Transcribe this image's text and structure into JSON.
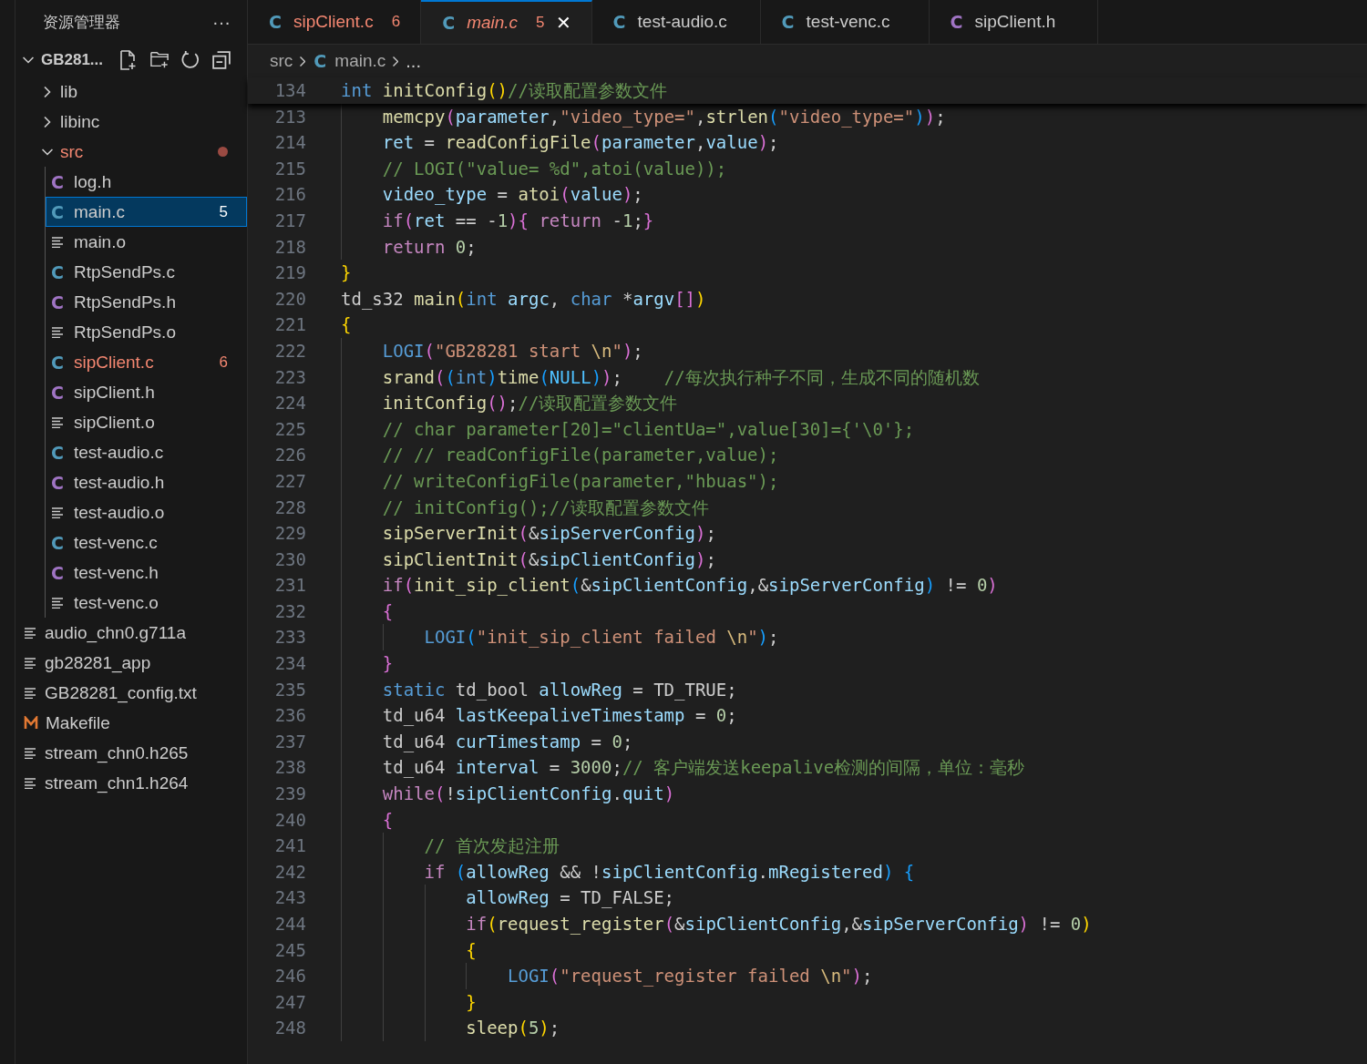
{
  "sidebar": {
    "title": "资源管理器",
    "more": "···",
    "root": {
      "label": "GB281...",
      "expanded": true
    },
    "items": [
      {
        "name": "lib",
        "kind": "folder",
        "expanded": false,
        "selected": false,
        "error": false
      },
      {
        "name": "libinc",
        "kind": "folder",
        "expanded": false,
        "selected": false,
        "error": false
      },
      {
        "name": "src",
        "kind": "folder",
        "expanded": true,
        "selected": false,
        "error": true,
        "children": [
          {
            "name": "log.h",
            "kind": "h",
            "icon": "C",
            "selected": false,
            "error": false
          },
          {
            "name": "main.c",
            "kind": "c",
            "icon": "C",
            "selected": true,
            "error": true,
            "badge": "5"
          },
          {
            "name": "main.o",
            "kind": "file",
            "selected": false,
            "error": false
          },
          {
            "name": "RtpSendPs.c",
            "kind": "c",
            "icon": "C",
            "selected": false,
            "error": false
          },
          {
            "name": "RtpSendPs.h",
            "kind": "h",
            "icon": "C",
            "selected": false,
            "error": false
          },
          {
            "name": "RtpSendPs.o",
            "kind": "file",
            "selected": false,
            "error": false
          },
          {
            "name": "sipClient.c",
            "kind": "c",
            "icon": "C",
            "selected": false,
            "error": true,
            "badge": "6"
          },
          {
            "name": "sipClient.h",
            "kind": "h",
            "icon": "C",
            "selected": false,
            "error": false
          },
          {
            "name": "sipClient.o",
            "kind": "file",
            "selected": false,
            "error": false
          },
          {
            "name": "test-audio.c",
            "kind": "c",
            "icon": "C",
            "selected": false,
            "error": false
          },
          {
            "name": "test-audio.h",
            "kind": "h",
            "icon": "C",
            "selected": false,
            "error": false
          },
          {
            "name": "test-audio.o",
            "kind": "file",
            "selected": false,
            "error": false
          },
          {
            "name": "test-venc.c",
            "kind": "c",
            "icon": "C",
            "selected": false,
            "error": false
          },
          {
            "name": "test-venc.h",
            "kind": "h",
            "icon": "C",
            "selected": false,
            "error": false
          },
          {
            "name": "test-venc.o",
            "kind": "file",
            "selected": false,
            "error": false
          }
        ]
      },
      {
        "name": "audio_chn0.g711a",
        "kind": "file",
        "selected": false,
        "error": false
      },
      {
        "name": "gb28281_app",
        "kind": "file",
        "selected": false,
        "error": false
      },
      {
        "name": "GB28281_config.txt",
        "kind": "file",
        "selected": false,
        "error": false
      },
      {
        "name": "Makefile",
        "kind": "makefile",
        "selected": false,
        "error": false
      },
      {
        "name": "stream_chn0.h265",
        "kind": "file",
        "selected": false,
        "error": false
      },
      {
        "name": "stream_chn1.h264",
        "kind": "file",
        "selected": false,
        "error": false
      }
    ]
  },
  "tabs": [
    {
      "label": "sipClient.c",
      "kind": "c",
      "icon": "C",
      "selected": false,
      "error": true,
      "italic": false,
      "badge": "6"
    },
    {
      "label": "main.c",
      "kind": "c",
      "icon": "C",
      "selected": true,
      "error": true,
      "italic": true,
      "badge": "5",
      "close": "✕"
    },
    {
      "label": "test-audio.c",
      "kind": "c",
      "icon": "C",
      "selected": false,
      "error": false,
      "italic": false
    },
    {
      "label": "test-venc.c",
      "kind": "c",
      "icon": "C",
      "selected": false,
      "error": false,
      "italic": false
    },
    {
      "label": "sipClient.h",
      "kind": "h",
      "icon": "C",
      "selected": false,
      "error": false,
      "italic": false
    }
  ],
  "breadcrumb": [
    {
      "label": "src",
      "kind": "folder"
    },
    {
      "label": "main.c",
      "kind": "c",
      "icon": "C"
    },
    {
      "label": "...",
      "kind": "more"
    }
  ],
  "sticky": {
    "number": "134",
    "tokens": [
      {
        "kind": "kw",
        "text": "int"
      },
      {
        "kind": "fn",
        "text": " initConfig"
      },
      {
        "kind": "b1",
        "text": "()"
      },
      {
        "kind": "cm",
        "text": "//读取配置参数文件"
      }
    ]
  },
  "lines": [
    {
      "children": [
        {
          "number": "213",
          "tokens": [
            {
              "kind": "fn",
              "text": "memcpy"
            },
            {
              "kind": "b2",
              "text": "("
            },
            {
              "kind": "var",
              "text": "parameter"
            },
            {
              "kind": "p",
              "text": ","
            },
            {
              "kind": "str",
              "text": "\"video_type=\""
            },
            {
              "kind": "p",
              "text": ","
            },
            {
              "kind": "fn",
              "text": "strlen"
            },
            {
              "kind": "b3",
              "text": "("
            },
            {
              "kind": "str",
              "text": "\"video_type=\""
            },
            {
              "kind": "b3",
              "text": ")"
            },
            {
              "kind": "b2",
              "text": ")"
            },
            {
              "kind": "p",
              "text": ";"
            }
          ]
        },
        {
          "number": "214",
          "tokens": [
            {
              "kind": "var",
              "text": "ret"
            },
            {
              "kind": "p",
              "text": " = "
            },
            {
              "kind": "fn",
              "text": "readConfigFile"
            },
            {
              "kind": "b2",
              "text": "("
            },
            {
              "kind": "var",
              "text": "parameter"
            },
            {
              "kind": "p",
              "text": ","
            },
            {
              "kind": "var",
              "text": "value"
            },
            {
              "kind": "b2",
              "text": ")"
            },
            {
              "kind": "p",
              "text": ";"
            }
          ]
        },
        {
          "number": "215",
          "tokens": [
            {
              "kind": "cm",
              "text": "// LOGI(\"value= %d\",atoi(value));"
            }
          ]
        },
        {
          "number": "216",
          "tokens": [
            {
              "kind": "var",
              "text": "video_type"
            },
            {
              "kind": "p",
              "text": " = "
            },
            {
              "kind": "fn",
              "text": "atoi"
            },
            {
              "kind": "b2",
              "text": "("
            },
            {
              "kind": "var",
              "text": "value"
            },
            {
              "kind": "b2",
              "text": ")"
            },
            {
              "kind": "p",
              "text": ";"
            }
          ]
        },
        {
          "number": "217",
          "tokens": [
            {
              "kind": "ctl",
              "text": "if"
            },
            {
              "kind": "b2",
              "text": "("
            },
            {
              "kind": "var",
              "text": "ret"
            },
            {
              "kind": "p",
              "text": " == -"
            },
            {
              "kind": "num",
              "text": "1"
            },
            {
              "kind": "b2",
              "text": ")"
            },
            {
              "kind": "b2",
              "text": "{"
            },
            {
              "kind": "ctl",
              "text": " return"
            },
            {
              "kind": "p",
              "text": " -"
            },
            {
              "kind": "num",
              "text": "1"
            },
            {
              "kind": "p",
              "text": ";"
            },
            {
              "kind": "b2",
              "text": "}"
            }
          ]
        },
        {
          "number": "218",
          "tokens": [
            {
              "kind": "ctl",
              "text": "return"
            },
            {
              "kind": "num",
              "text": " 0"
            },
            {
              "kind": "p",
              "text": ";"
            }
          ]
        }
      ]
    },
    {
      "number": "219",
      "tokens": [
        {
          "kind": "b1",
          "text": "}"
        }
      ]
    },
    {
      "number": "220",
      "tokens": [
        {
          "kind": "p",
          "text": "td_s32"
        },
        {
          "kind": "fn",
          "text": " main"
        },
        {
          "kind": "b1",
          "text": "("
        },
        {
          "kind": "kw",
          "text": "int"
        },
        {
          "kind": "var",
          "text": " argc"
        },
        {
          "kind": "p",
          "text": ", "
        },
        {
          "kind": "kw",
          "text": "char"
        },
        {
          "kind": "p",
          "text": " *"
        },
        {
          "kind": "var",
          "text": "argv"
        },
        {
          "kind": "b2",
          "text": "[]"
        },
        {
          "kind": "b1",
          "text": ")"
        }
      ]
    },
    {
      "number": "221",
      "tokens": [
        {
          "kind": "b1",
          "text": "{"
        }
      ]
    },
    {
      "children": [
        {
          "number": "222",
          "tokens": [
            {
              "kind": "kw",
              "text": "LOGI"
            },
            {
              "kind": "b2",
              "text": "("
            },
            {
              "kind": "str",
              "text": "\"GB28281 start "
            },
            {
              "kind": "esc",
              "text": "\\n"
            },
            {
              "kind": "str",
              "text": "\""
            },
            {
              "kind": "b2",
              "text": ")"
            },
            {
              "kind": "p",
              "text": ";"
            }
          ]
        },
        {
          "number": "223",
          "tokens": [
            {
              "kind": "fn",
              "text": "srand"
            },
            {
              "kind": "b2",
              "text": "("
            },
            {
              "kind": "b3",
              "text": "("
            },
            {
              "kind": "kw",
              "text": "int"
            },
            {
              "kind": "b3",
              "text": ")"
            },
            {
              "kind": "fn",
              "text": "time"
            },
            {
              "kind": "b3",
              "text": "("
            },
            {
              "kind": "mac",
              "text": "NULL"
            },
            {
              "kind": "b3",
              "text": ")"
            },
            {
              "kind": "b2",
              "text": ")"
            },
            {
              "kind": "p",
              "text": ";"
            },
            {
              "kind": "cm",
              "text": "    //每次执行种子不同，生成不同的随机数"
            }
          ]
        },
        {
          "number": "224",
          "tokens": [
            {
              "kind": "fn",
              "text": "initConfig"
            },
            {
              "kind": "b2",
              "text": "()"
            },
            {
              "kind": "p",
              "text": ";"
            },
            {
              "kind": "cm",
              "text": "//读取配置参数文件"
            }
          ]
        },
        {
          "number": "225",
          "tokens": [
            {
              "kind": "cm",
              "text": "// char parameter[20]=\"clientUa=\",value[30]={'\\0'};"
            }
          ]
        },
        {
          "number": "226",
          "tokens": [
            {
              "kind": "cm",
              "text": "// // readConfigFile(parameter,value);"
            }
          ]
        },
        {
          "number": "227",
          "tokens": [
            {
              "kind": "cm",
              "text": "// writeConfigFile(parameter,\"hbuas\");"
            }
          ]
        },
        {
          "number": "228",
          "tokens": [
            {
              "kind": "cm",
              "text": "// initConfig();//读取配置参数文件"
            }
          ]
        },
        {
          "number": "229",
          "tokens": [
            {
              "kind": "fn",
              "text": "sipServerInit"
            },
            {
              "kind": "b2",
              "text": "("
            },
            {
              "kind": "p",
              "text": "&"
            },
            {
              "kind": "var",
              "text": "sipServerConfig"
            },
            {
              "kind": "b2",
              "text": ")"
            },
            {
              "kind": "p",
              "text": ";"
            }
          ]
        },
        {
          "number": "230",
          "tokens": [
            {
              "kind": "fn",
              "text": "sipClientInit"
            },
            {
              "kind": "b2",
              "text": "("
            },
            {
              "kind": "p",
              "text": "&"
            },
            {
              "kind": "var",
              "text": "sipClientConfig"
            },
            {
              "kind": "b2",
              "text": ")"
            },
            {
              "kind": "p",
              "text": ";"
            }
          ]
        },
        {
          "number": "231",
          "tokens": [
            {
              "kind": "ctl",
              "text": "if"
            },
            {
              "kind": "b2",
              "text": "("
            },
            {
              "kind": "fn",
              "text": "init_sip_client"
            },
            {
              "kind": "b3",
              "text": "("
            },
            {
              "kind": "p",
              "text": "&"
            },
            {
              "kind": "var",
              "text": "sipClientConfig"
            },
            {
              "kind": "p",
              "text": ",&"
            },
            {
              "kind": "var",
              "text": "sipServerConfig"
            },
            {
              "kind": "b3",
              "text": ")"
            },
            {
              "kind": "p",
              "text": " != "
            },
            {
              "kind": "num",
              "text": "0"
            },
            {
              "kind": "b2",
              "text": ")"
            }
          ]
        },
        {
          "number": "232",
          "tokens": [
            {
              "kind": "b2",
              "text": "{"
            }
          ]
        },
        {
          "children": [
            {
              "number": "233",
              "tokens": [
                {
                  "kind": "kw",
                  "text": "LOGI"
                },
                {
                  "kind": "b3",
                  "text": "("
                },
                {
                  "kind": "str",
                  "text": "\"init_sip_client failed "
                },
                {
                  "kind": "esc",
                  "text": "\\n"
                },
                {
                  "kind": "str",
                  "text": "\""
                },
                {
                  "kind": "b3",
                  "text": ")"
                },
                {
                  "kind": "p",
                  "text": ";"
                }
              ]
            }
          ]
        },
        {
          "number": "234",
          "tokens": [
            {
              "kind": "b2",
              "text": "}"
            }
          ]
        },
        {
          "number": "235",
          "tokens": [
            {
              "kind": "kw",
              "text": "static"
            },
            {
              "kind": "p",
              "text": " td_bool"
            },
            {
              "kind": "var",
              "text": " allowReg"
            },
            {
              "kind": "p",
              "text": " = TD_TRUE;"
            }
          ]
        },
        {
          "number": "236",
          "tokens": [
            {
              "kind": "p",
              "text": "td_u64"
            },
            {
              "kind": "var",
              "text": " lastKeepaliveTimestamp"
            },
            {
              "kind": "p",
              "text": " = "
            },
            {
              "kind": "num",
              "text": "0"
            },
            {
              "kind": "p",
              "text": ";"
            }
          ]
        },
        {
          "number": "237",
          "tokens": [
            {
              "kind": "p",
              "text": "td_u64"
            },
            {
              "kind": "var",
              "text": " curTimestamp"
            },
            {
              "kind": "p",
              "text": " = "
            },
            {
              "kind": "num",
              "text": "0"
            },
            {
              "kind": "p",
              "text": ";"
            }
          ]
        },
        {
          "number": "238",
          "tokens": [
            {
              "kind": "p",
              "text": "td_u64"
            },
            {
              "kind": "var",
              "text": " interval"
            },
            {
              "kind": "p",
              "text": " = "
            },
            {
              "kind": "num",
              "text": "3000"
            },
            {
              "kind": "p",
              "text": ";"
            },
            {
              "kind": "cm",
              "text": "// 客户端发送keepalive检测的间隔，单位：毫秒"
            }
          ]
        },
        {
          "number": "239",
          "tokens": [
            {
              "kind": "ctl",
              "text": "while"
            },
            {
              "kind": "b2",
              "text": "("
            },
            {
              "kind": "p",
              "text": "!"
            },
            {
              "kind": "var",
              "text": "sipClientConfig"
            },
            {
              "kind": "p",
              "text": "."
            },
            {
              "kind": "var",
              "text": "quit"
            },
            {
              "kind": "b2",
              "text": ")"
            }
          ]
        },
        {
          "number": "240",
          "tokens": [
            {
              "kind": "b2",
              "text": "{"
            }
          ]
        },
        {
          "children": [
            {
              "number": "241",
              "tokens": [
                {
                  "kind": "cm",
                  "text": "// 首次发起注册"
                }
              ]
            },
            {
              "number": "242",
              "tokens": [
                {
                  "kind": "ctl",
                  "text": "if"
                },
                {
                  "kind": "b3",
                  "text": " ("
                },
                {
                  "kind": "var",
                  "text": "allowReg"
                },
                {
                  "kind": "p",
                  "text": " && !"
                },
                {
                  "kind": "var",
                  "text": "sipClientConfig"
                },
                {
                  "kind": "p",
                  "text": "."
                },
                {
                  "kind": "var",
                  "text": "mRegistered"
                },
                {
                  "kind": "b3",
                  "text": ")"
                },
                {
                  "kind": "b3",
                  "text": " {"
                }
              ]
            },
            {
              "children": [
                {
                  "number": "243",
                  "tokens": [
                    {
                      "kind": "var",
                      "text": "allowReg"
                    },
                    {
                      "kind": "p",
                      "text": " = TD_FALSE;"
                    }
                  ]
                },
                {
                  "number": "244",
                  "tokens": [
                    {
                      "kind": "ctl",
                      "text": "if"
                    },
                    {
                      "kind": "b1",
                      "text": "("
                    },
                    {
                      "kind": "fn",
                      "text": "request_register"
                    },
                    {
                      "kind": "b2",
                      "text": "("
                    },
                    {
                      "kind": "p",
                      "text": "&"
                    },
                    {
                      "kind": "var",
                      "text": "sipClientConfig"
                    },
                    {
                      "kind": "p",
                      "text": ",&"
                    },
                    {
                      "kind": "var",
                      "text": "sipServerConfig"
                    },
                    {
                      "kind": "b2",
                      "text": ")"
                    },
                    {
                      "kind": "p",
                      "text": " != "
                    },
                    {
                      "kind": "num",
                      "text": "0"
                    },
                    {
                      "kind": "b1",
                      "text": ")"
                    }
                  ]
                },
                {
                  "number": "245",
                  "tokens": [
                    {
                      "kind": "b1",
                      "text": "{"
                    }
                  ]
                },
                {
                  "children": [
                    {
                      "number": "246",
                      "tokens": [
                        {
                          "kind": "kw",
                          "text": "LOGI"
                        },
                        {
                          "kind": "b2",
                          "text": "("
                        },
                        {
                          "kind": "str",
                          "text": "\"request_register failed "
                        },
                        {
                          "kind": "esc",
                          "text": "\\n"
                        },
                        {
                          "kind": "str",
                          "text": "\""
                        },
                        {
                          "kind": "b2",
                          "text": ")"
                        },
                        {
                          "kind": "p",
                          "text": ";"
                        }
                      ]
                    }
                  ]
                },
                {
                  "number": "247",
                  "tokens": [
                    {
                      "kind": "b1",
                      "text": "}"
                    }
                  ]
                },
                {
                  "number": "248",
                  "tokens": [
                    {
                      "kind": "fn",
                      "text": "sleep"
                    },
                    {
                      "kind": "b1",
                      "text": "("
                    },
                    {
                      "kind": "num",
                      "text": "5"
                    },
                    {
                      "kind": "b1",
                      "text": ")"
                    },
                    {
                      "kind": "p",
                      "text": ";"
                    }
                  ]
                }
              ]
            }
          ]
        }
      ]
    }
  ]
}
